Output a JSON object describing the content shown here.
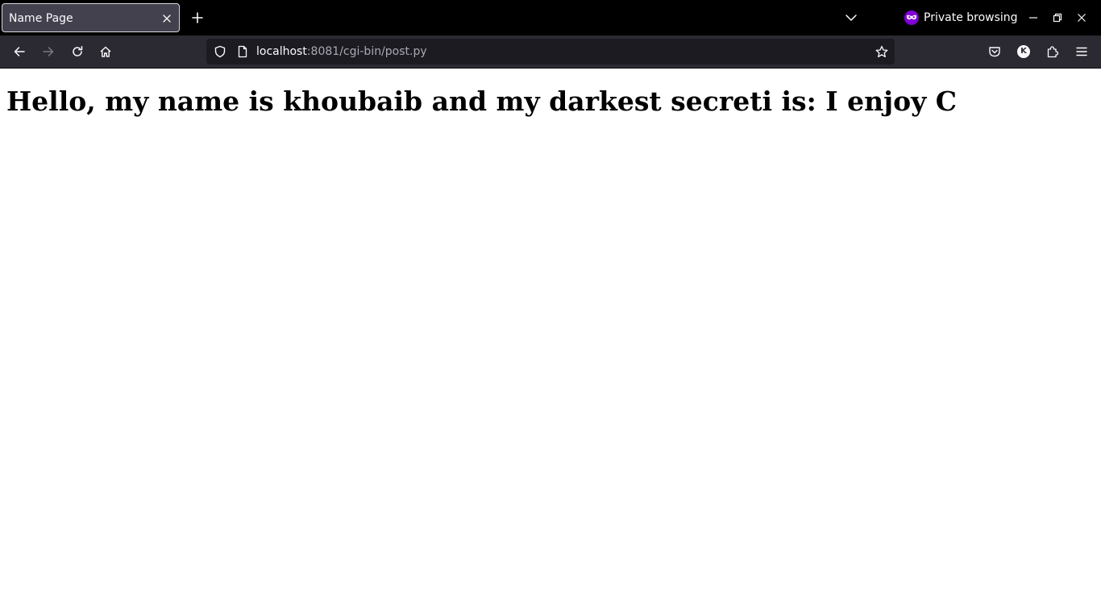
{
  "tab": {
    "title": "Name Page"
  },
  "window": {
    "private_label": "Private browsing"
  },
  "urlbar": {
    "host": "localhost",
    "path": ":8081/cgi-bin/post.py"
  },
  "toolbar": {
    "account_initial": "K"
  },
  "page": {
    "heading": "Hello, my name is khoubaib and my darkest secreti is: I enjoy C"
  },
  "icons": {
    "tab_close": "close-icon",
    "new_tab": "plus-icon",
    "tab_list": "chevron-down-icon",
    "private": "private-mask-icon",
    "minimize": "minimize-icon",
    "restore": "restore-icon",
    "close_window": "close-icon",
    "back": "arrow-left-icon",
    "forward": "arrow-right-icon",
    "reload": "reload-icon",
    "home": "home-icon",
    "tracking": "shield-icon",
    "page_info": "page-icon",
    "bookmark": "star-icon",
    "pocket": "pocket-icon",
    "extensions": "puzzle-icon",
    "menu": "hamburger-icon"
  },
  "colors": {
    "tabstrip_bg": "#000000",
    "navbar_bg": "#2b2a33",
    "urlbar_bg": "#1c1b22",
    "private_accent": "#8000d7",
    "page_bg": "#ffffff"
  }
}
